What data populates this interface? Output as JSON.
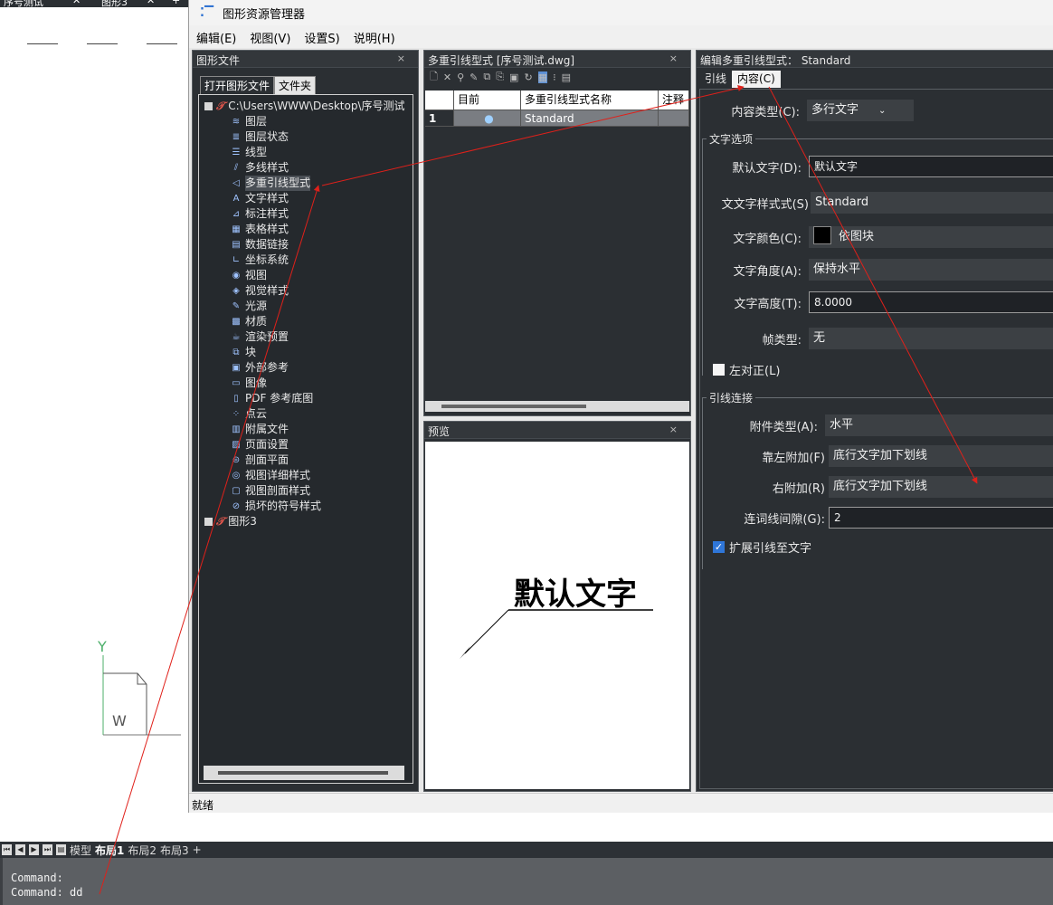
{
  "cad": {
    "tab_title": "序号测试",
    "tab_close": "✕",
    "tab2_title": "图形3",
    "tab2_close": "✕",
    "tab_add": "+",
    "ucs_y": "Y",
    "ucs_w": "W",
    "layout_tabs": [
      "模型",
      "布局1",
      "布局2",
      "布局3",
      "+"
    ],
    "command_lines": [
      "Command:",
      "Command: dd"
    ]
  },
  "window": {
    "title": "图形资源管理器",
    "menu": [
      "编辑(E)",
      "视图(V)",
      "设置S)",
      "说明(H)"
    ],
    "status": "就绪"
  },
  "files_panel": {
    "title": "图形文件",
    "close": "×",
    "tabs": [
      "打开图形文件",
      "文件夹"
    ],
    "root": "C:\\Users\\WWW\\Desktop\\序号测试",
    "items": [
      {
        "label": "图层",
        "icon": "layers-icon",
        "glyph": "≋"
      },
      {
        "label": "图层状态",
        "icon": "layer-state-icon",
        "glyph": "≣"
      },
      {
        "label": "线型",
        "icon": "linetype-icon",
        "glyph": "☰"
      },
      {
        "label": "多线样式",
        "icon": "multiline-icon",
        "glyph": "⫽"
      },
      {
        "label": "多重引线型式",
        "icon": "multileader-icon",
        "glyph": "◁"
      },
      {
        "label": "文字样式",
        "icon": "text-style-icon",
        "glyph": "A"
      },
      {
        "label": "标注样式",
        "icon": "dimension-icon",
        "glyph": "⊿"
      },
      {
        "label": "表格样式",
        "icon": "table-icon",
        "glyph": "▦"
      },
      {
        "label": "数据链接",
        "icon": "data-link-icon",
        "glyph": "▤"
      },
      {
        "label": "坐标系统",
        "icon": "ucs-icon",
        "glyph": "∟"
      },
      {
        "label": "视图",
        "icon": "view-icon",
        "glyph": "◉"
      },
      {
        "label": "视觉样式",
        "icon": "visual-style-icon",
        "glyph": "◈"
      },
      {
        "label": "光源",
        "icon": "light-icon",
        "glyph": "✎"
      },
      {
        "label": "材质",
        "icon": "material-icon",
        "glyph": "▩"
      },
      {
        "label": "渲染预置",
        "icon": "render-icon",
        "glyph": "☕"
      },
      {
        "label": "块",
        "icon": "block-icon",
        "glyph": "⧉"
      },
      {
        "label": "外部参考",
        "icon": "xref-icon",
        "glyph": "▣"
      },
      {
        "label": "图像",
        "icon": "image-icon",
        "glyph": "▭"
      },
      {
        "label": "PDF 参考底图",
        "icon": "pdf-icon",
        "glyph": "▯"
      },
      {
        "label": "点云",
        "icon": "point-cloud-icon",
        "glyph": "⁘"
      },
      {
        "label": "附属文件",
        "icon": "attached-file-icon",
        "glyph": "▥"
      },
      {
        "label": "页面设置",
        "icon": "page-setup-icon",
        "glyph": "▨"
      },
      {
        "label": "剖面平面",
        "icon": "section-plane-icon",
        "glyph": "⊜"
      },
      {
        "label": "视图详细样式",
        "icon": "detail-view-icon",
        "glyph": "◎"
      },
      {
        "label": "视图剖面样式",
        "icon": "section-view-icon",
        "glyph": "▢"
      },
      {
        "label": "损坏的符号样式",
        "icon": "broken-symbol-icon",
        "glyph": "⊘"
      }
    ],
    "second_drawing": "图形3",
    "selected_index": 4
  },
  "list_panel": {
    "title": "多重引线型式 [序号测试.dwg]",
    "close": "×",
    "toolbar_glyphs": [
      "🗋",
      "✕",
      "⚲",
      "✎",
      "⧉",
      "⎘",
      "▣",
      "↻",
      "▦",
      "⁝",
      "▤"
    ],
    "columns": [
      "",
      "目前",
      "多重引线型式名称",
      "注释"
    ],
    "rows": [
      {
        "num": "1",
        "current": "●",
        "name": "Standard",
        "note": ""
      }
    ]
  },
  "preview_panel": {
    "title": "预览",
    "close": "×",
    "sample_text": "默认文字"
  },
  "edit_panel": {
    "title": "编辑多重引线型式： Standard",
    "tabs": [
      "引线",
      "内容(C)"
    ],
    "content_type_label": "内容类型(C):",
    "content_type_value": "多行文字",
    "text_options_title": "文字选项",
    "default_text_label": "默认文字(D):",
    "default_text_value": "默认文字",
    "text_style_label": "文文字样式式(S)",
    "text_style_value": "Standard",
    "text_color_label": "文字颜色(C):",
    "text_color_value": "依图块",
    "text_angle_label": "文字角度(A):",
    "text_angle_value": "保持水平",
    "text_height_label": "文字高度(T):",
    "text_height_value": "8.0000",
    "frame_label": "帧类型:",
    "frame_value": "无",
    "left_justify_label": "左对正(L)",
    "left_justify_checked": false,
    "leader_conn_title": "引线连接",
    "attach_type_label": "附件类型(A):",
    "attach_type_value": "水平",
    "left_attach_label": "靠左附加(F)",
    "left_attach_value": "底行文字加下划线",
    "right_attach_label": "右附加(R)",
    "right_attach_value": "底行文字加下划线",
    "gap_label": "连词线间隙(G):",
    "gap_value": "2",
    "extend_label": "扩展引线至文字",
    "extend_checked": true
  }
}
